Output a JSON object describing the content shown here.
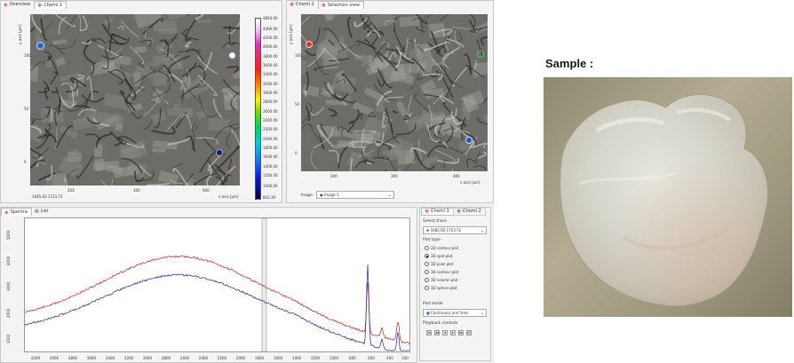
{
  "overview_panel": {
    "tabs": [
      {
        "label": "Overview",
        "icon": "overview-icon",
        "active": false
      },
      {
        "label": "Chemi 1",
        "icon": "chemical-image-icon",
        "active": true
      }
    ],
    "y_axis_label": "y axis [µm]",
    "x_axis_label": "x axis [µm]",
    "coordinate_readout": "1685.62-1723.72",
    "x_ticks": [
      "200",
      "300",
      "400"
    ],
    "y_ticks": [
      "100",
      "50",
      "0"
    ],
    "colorbar_ticks": [
      "4804.60",
      "4400.00",
      "4200.00",
      "4000.00",
      "3800.00",
      "3600.00",
      "3400.00",
      "3200.00",
      "3000.00",
      "2800.00",
      "2600.00",
      "2400.00",
      "2200.00",
      "2000.00",
      "1800.00",
      "1600.00",
      "1400.00",
      "1200.00",
      "1000.00",
      "843.39"
    ],
    "marker_colors": [
      "#2a6bd6",
      "#f4f4f4",
      "#1a1a78"
    ]
  },
  "selection_panel": {
    "tabs": [
      {
        "label": "Chemi 2",
        "icon": "chemical-image-icon",
        "active": false
      },
      {
        "label": "Selection view",
        "icon": "selection-icon",
        "active": true
      }
    ],
    "y_axis_label": "y axis [µm]",
    "x_axis_label": "x axis [µm]",
    "x_ticks": [
      "200",
      "300",
      "400"
    ],
    "y_ticks": [
      "100",
      "50",
      "0"
    ],
    "image_label": "Image:",
    "image_select": "Image 1",
    "marker_colors": [
      "#d03a2a",
      "#5fbf6a",
      "#2a50c8"
    ]
  },
  "spectra_panel": {
    "tabs": [
      {
        "label": "Spectra",
        "icon": "spectra-icon",
        "active": true
      },
      {
        "label": "List",
        "icon": "list-icon",
        "active": false
      }
    ],
    "x_ticks": [
      "4200",
      "4000",
      "3800",
      "3600",
      "3400",
      "3200",
      "3000",
      "2800",
      "2600",
      "2400",
      "2200",
      "2000",
      "1800",
      "1600",
      "1400",
      "1200",
      "1000",
      "800",
      "600",
      "400",
      "200"
    ],
    "y_ticks": [
      "1000",
      "2000",
      "3000",
      "4000",
      "5000"
    ],
    "series_colors": [
      "#c33c3c",
      "#3c3c9a"
    ]
  },
  "plot_controls": {
    "tabs": [
      {
        "label": "Chemi 1",
        "active": true
      },
      {
        "label": "Chemi 2",
        "active": false
      }
    ],
    "select_trace_label": "Select trace",
    "select_trace_value": "1685.62-1723.72",
    "plot_type_label": "Plot type",
    "plot_types": [
      {
        "label": "2D contour plot",
        "selected": false
      },
      {
        "label": "3D spot plot",
        "selected": true
      },
      {
        "label": "3D pixel plot",
        "selected": false
      },
      {
        "label": "3D contour plot",
        "selected": false
      },
      {
        "label": "3D column plot",
        "selected": false
      },
      {
        "label": "3D sphere plot",
        "selected": false
      }
    ],
    "plot_mode_label": "Plot mode",
    "plot_mode_value": "Continuous and lines",
    "playback_label": "Playback controls",
    "playback_buttons": [
      "|◂",
      "◂◂",
      "◂",
      "▸",
      "▸▸",
      "▸|"
    ]
  },
  "sample": {
    "title": "Sample :"
  }
}
